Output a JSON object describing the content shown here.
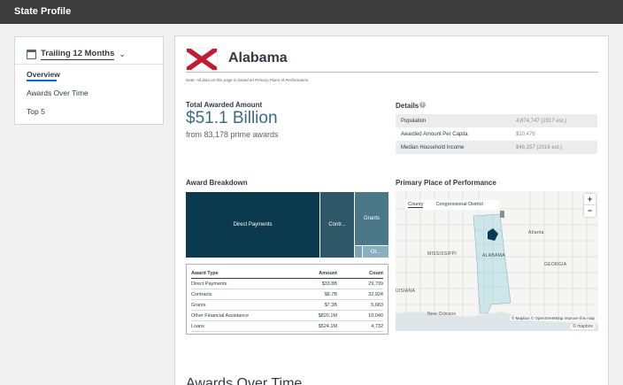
{
  "topbar": {
    "title": "State Profile"
  },
  "sidebar": {
    "period_label": "Trailing 12 Months",
    "items": [
      {
        "label": "Overview",
        "active": true
      },
      {
        "label": "Awards Over Time",
        "active": false
      },
      {
        "label": "Top 5",
        "active": false
      }
    ]
  },
  "header": {
    "state_name": "Alabama",
    "note": "Note: All data on this page is based on Primary Place of Performance."
  },
  "summary": {
    "heading": "Total Awarded Amount",
    "amount": "$51.1 Billion",
    "from_line": "from 83,178 prime awards"
  },
  "details": {
    "heading": "Details",
    "rows": [
      {
        "label": "Population",
        "value": "4,874,747 (2017 est.)"
      },
      {
        "label": "Awarded Amount Per Capita",
        "value": "$10,476"
      },
      {
        "label": "Median Household Income",
        "value": "$46,257 (2016 est.)"
      }
    ]
  },
  "breakdown": {
    "heading": "Award Breakdown",
    "treemap": [
      {
        "label": "Direct Payments",
        "color": "#0b3a4e"
      },
      {
        "label": "Contr...",
        "color": "#2e5868"
      },
      {
        "label": "Grants",
        "color": "#4b7889"
      },
      {
        "label": "",
        "color": "#7fa3b0"
      },
      {
        "label": "Ot...",
        "color": "#8ab0bf"
      }
    ],
    "table": {
      "headers": [
        "Award Type",
        "Amount",
        "Count"
      ],
      "rows": [
        [
          "Direct Payments",
          "$33.8B",
          "29,799"
        ],
        [
          "Contracts",
          "$8.7B",
          "32,924"
        ],
        [
          "Grants",
          "$7.3B",
          "5,683"
        ],
        [
          "Other Financial Assistance",
          "$820.1M",
          "10,040"
        ],
        [
          "Loans",
          "$524.1M",
          "4,732"
        ]
      ]
    }
  },
  "map": {
    "heading": "Primary Place of Performance",
    "tabs": [
      "County",
      "Congressional District"
    ],
    "labels": {
      "mississippi": "MISSISSIPPI",
      "alabama": "ALABAMA",
      "georgia": "GEORGIA",
      "louisiana": "UISIANA",
      "new_orleans": "New Orleans",
      "atlanta": "Atlanta"
    },
    "zoom_in": "+",
    "zoom_out": "−",
    "attribution": "© Mapbox © OpenStreetMap  Improve this map",
    "logo": "© mapbox",
    "colors": {
      "highlight": "#cde6ea",
      "selected": "#0b3a4e",
      "land": "#f5f5f3"
    }
  },
  "next_section": {
    "title": "Awards Over Time"
  },
  "colors": {
    "topbar": "#3c3c3c",
    "accent": "#0071bc",
    "amount": "#3d6a83"
  }
}
